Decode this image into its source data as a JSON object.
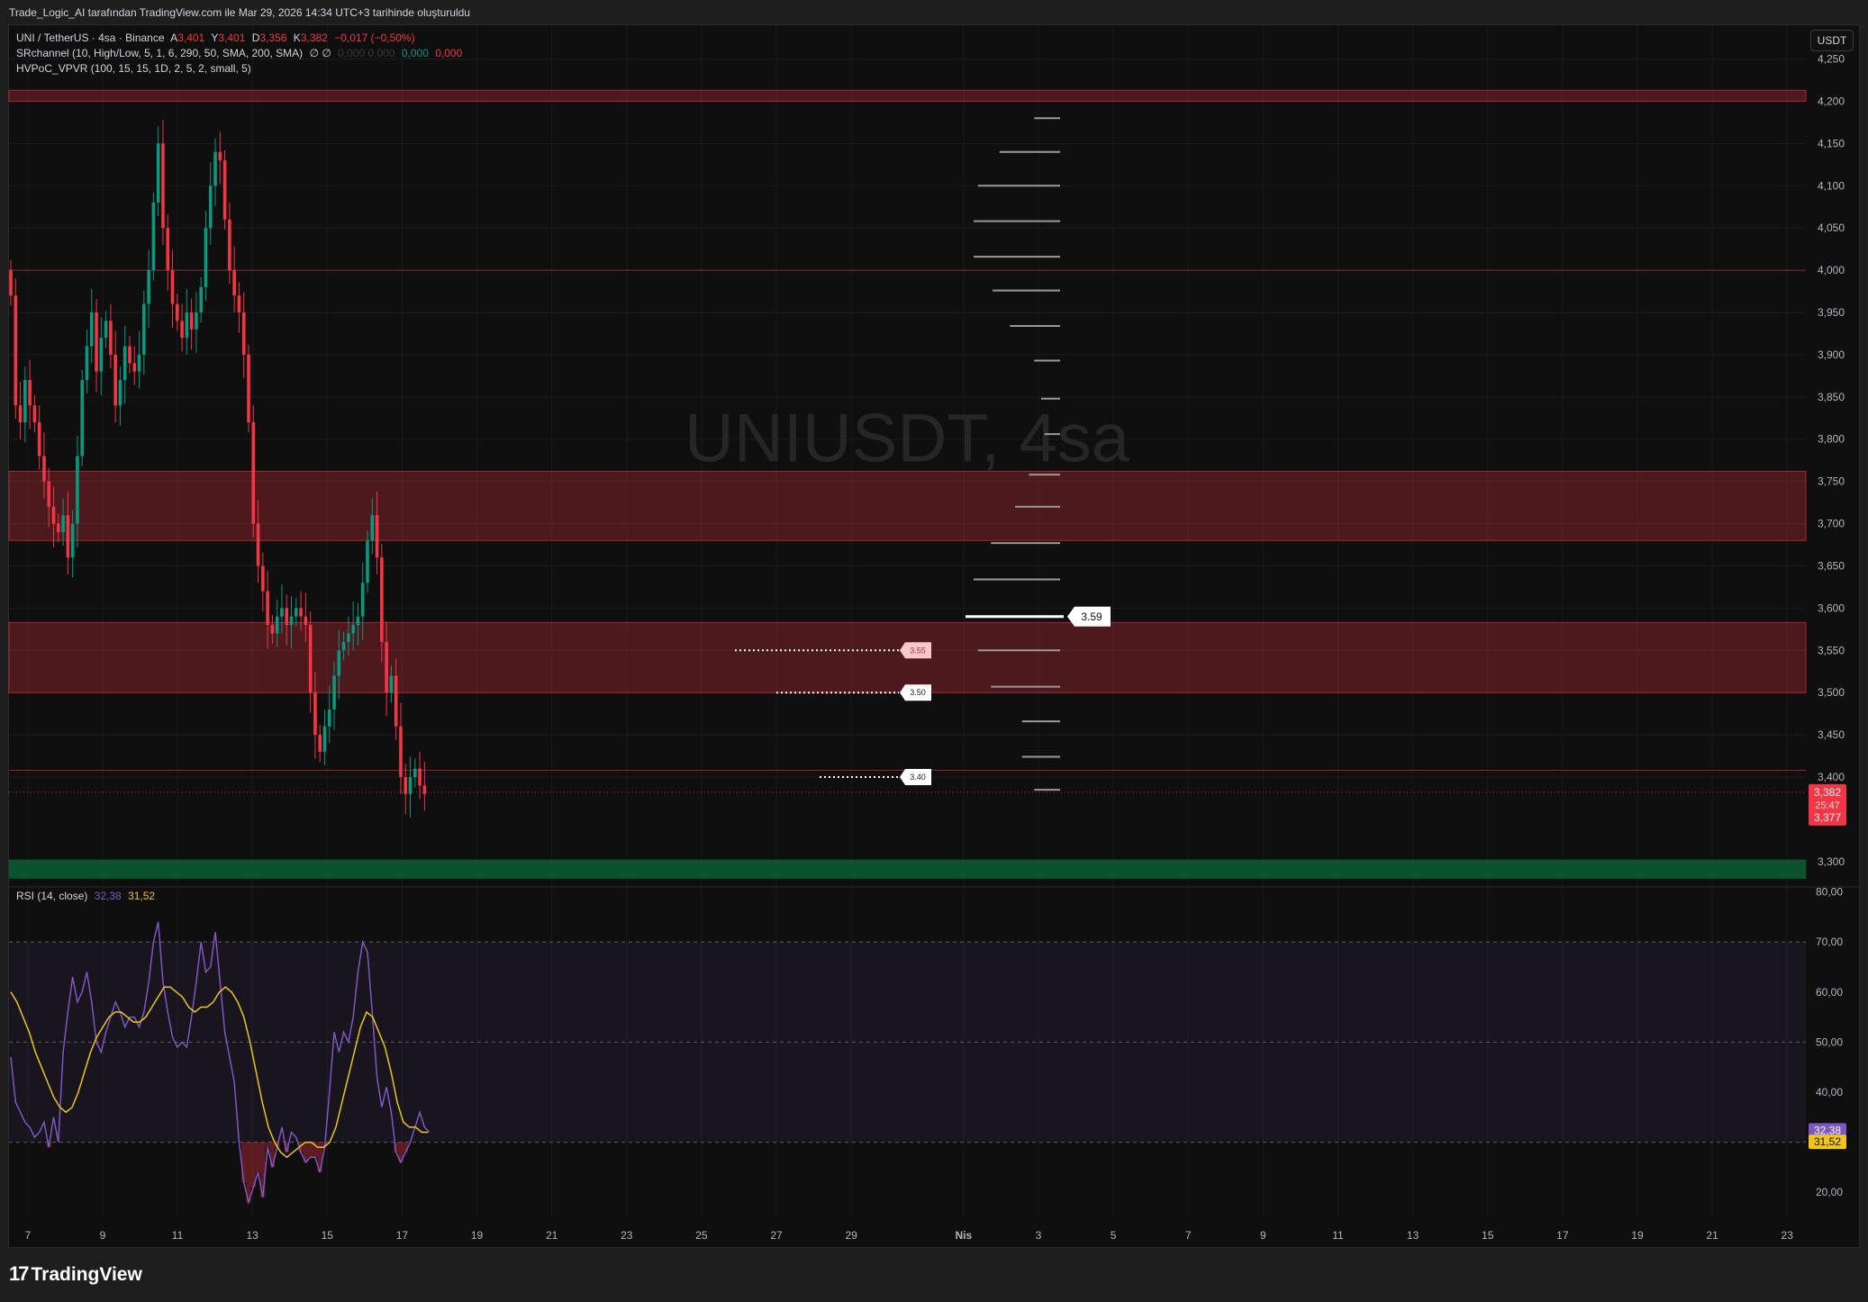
{
  "header": {
    "attribution": "Trade_Logic_AI tarafından TradingView.com ile Mar 29, 2026 14:34 UTC+3 tarihinde oluşturuldu"
  },
  "legend": {
    "symbol": "UNI / TetherUS · 4sa · Binance",
    "open_label": "A",
    "open": "3,401",
    "high_label": "Y",
    "high": "3,401",
    "low_label": "D",
    "low": "3,356",
    "close_label": "K",
    "close": "3,382",
    "change": "−0,017 (−0,50%)",
    "indicator1": "SRchannel (10, High/Low, 5, 1, 6, 290, 50, SMA, 200, SMA)",
    "indicator1_icon": "∅ ∅",
    "indicator1_dim": "0,000 0,000",
    "indicator1_v1": "0,000",
    "indicator1_v2": "0,000",
    "indicator2": "HVPoC_VPVR (100, 15, 15, 1D, 2, 5, 2, small, 5)",
    "rsi_label": "RSI (14, close)",
    "rsi_value": "32,38",
    "rsi_ma_value": "31,52"
  },
  "currency_button": "USDT",
  "watermark": "UNIUSDT, 4sa",
  "brand": {
    "logo": "17",
    "name": "TradingView"
  },
  "colors": {
    "up": "#089981",
    "down": "#f23645",
    "zone": "#f23645",
    "support": "#0b5e34",
    "rsi": "#7e57c2",
    "rsi_ma": "#f0c419",
    "background": "#0f0f0f"
  },
  "chart_data": [
    {
      "type": "candlestick",
      "title": "UNIUSDT, 4sa",
      "ylim": [
        3.27,
        4.29
      ],
      "y_ticks": [
        "4,250",
        "4,200",
        "4,150",
        "4,100",
        "4,050",
        "4,000",
        "3,950",
        "3,900",
        "3,850",
        "3,800",
        "3,750",
        "3,700",
        "3,650",
        "3,600",
        "3,550",
        "3,500",
        "3,450",
        "3,400",
        "3,300"
      ],
      "x_ticks": [
        "7",
        "9",
        "11",
        "13",
        "15",
        "17",
        "19",
        "21",
        "23",
        "25",
        "27",
        "29",
        "Nis",
        "3",
        "5",
        "7",
        "9",
        "11",
        "13",
        "15",
        "17",
        "19",
        "21",
        "23"
      ],
      "x_tick_values": [
        7,
        9,
        11,
        13,
        15,
        17,
        19,
        21,
        23,
        25,
        27,
        29,
        32,
        34,
        36,
        38,
        40,
        42,
        44,
        46,
        48,
        50,
        52,
        54
      ],
      "xlim": [
        6.5,
        54.5
      ],
      "last_price_label": "3,382",
      "countdown_label": "25:47",
      "last_low_label": "3,377",
      "last_price": 3.382,
      "zones": [
        {
          "from": 4.2,
          "to": 4.213,
          "kind": "resistance"
        },
        {
          "from": 3.68,
          "to": 3.762,
          "kind": "resistance"
        },
        {
          "from": 3.5,
          "to": 3.583,
          "kind": "resistance"
        },
        {
          "from": 3.28,
          "to": 3.302,
          "kind": "support"
        }
      ],
      "levels": [
        4.0,
        3.408
      ],
      "hvpoc": {
        "price": 3.59,
        "label": "3.59"
      },
      "price_tags": [
        {
          "price": 3.55,
          "label": "3.55",
          "style": "pink"
        },
        {
          "price": 3.5,
          "label": "3.50",
          "style": "white"
        },
        {
          "price": 3.4,
          "label": "3.40",
          "style": "white"
        }
      ],
      "volume_profile": [
        {
          "price": 4.18,
          "size": 0.3
        },
        {
          "price": 4.14,
          "size": 0.7
        },
        {
          "price": 4.1,
          "size": 0.95
        },
        {
          "price": 4.058,
          "size": 1.0
        },
        {
          "price": 4.016,
          "size": 1.0
        },
        {
          "price": 3.976,
          "size": 0.78
        },
        {
          "price": 3.934,
          "size": 0.58
        },
        {
          "price": 3.893,
          "size": 0.3
        },
        {
          "price": 3.848,
          "size": 0.22
        },
        {
          "price": 3.806,
          "size": 0.18
        },
        {
          "price": 3.758,
          "size": 0.36
        },
        {
          "price": 3.72,
          "size": 0.52
        },
        {
          "price": 3.677,
          "size": 0.8
        },
        {
          "price": 3.634,
          "size": 1.0
        },
        {
          "price": 3.55,
          "size": 0.95
        },
        {
          "price": 3.507,
          "size": 0.8
        },
        {
          "price": 3.466,
          "size": 0.44
        },
        {
          "price": 3.424,
          "size": 0.44
        },
        {
          "price": 3.385,
          "size": 0.3
        }
      ],
      "price_series": [
        3.97,
        3.84,
        3.82,
        3.87,
        3.84,
        3.82,
        3.78,
        3.75,
        3.72,
        3.7,
        3.69,
        3.71,
        3.66,
        3.7,
        3.78,
        3.87,
        3.91,
        3.95,
        3.88,
        3.92,
        3.94,
        3.9,
        3.84,
        3.87,
        3.91,
        3.89,
        3.88,
        3.9,
        3.96,
        4.0,
        4.08,
        4.15,
        4.05,
        4.0,
        3.96,
        3.94,
        3.92,
        3.95,
        3.93,
        3.95,
        3.98,
        4.05,
        4.1,
        4.14,
        4.13,
        4.06,
        4.0,
        3.97,
        3.95,
        3.9,
        3.82,
        3.7,
        3.65,
        3.62,
        3.58,
        3.57,
        3.59,
        3.6,
        3.58,
        3.59,
        3.6,
        3.59,
        3.58,
        3.5,
        3.45,
        3.43,
        3.46,
        3.48,
        3.52,
        3.55,
        3.56,
        3.57,
        3.58,
        3.59,
        3.63,
        3.68,
        3.71,
        3.66,
        3.56,
        3.5,
        3.52,
        3.46,
        3.4,
        3.38,
        3.4,
        3.41,
        3.39,
        3.38
      ]
    },
    {
      "type": "line",
      "title": "RSI (14, close)",
      "ylim": [
        15,
        81
      ],
      "y_ticks": [
        "80,00",
        "70,00",
        "60,00",
        "50,00",
        "40,00",
        "30,00",
        "20,00"
      ],
      "bands": {
        "upper": 70,
        "middle": 50,
        "lower": 30
      },
      "series": [
        {
          "name": "RSI",
          "color": "#7e57c2",
          "last_label": "32,38",
          "values": [
            47,
            38,
            36,
            34,
            33,
            31,
            32,
            34,
            29,
            35,
            30,
            48,
            56,
            63,
            58,
            60,
            64,
            58,
            50,
            48,
            52,
            55,
            58,
            56,
            53,
            55,
            55,
            53,
            56,
            62,
            70,
            74,
            62,
            56,
            51,
            49,
            50,
            49,
            55,
            62,
            70,
            64,
            65,
            72,
            62,
            52,
            47,
            42,
            30,
            22,
            18,
            21,
            24,
            19,
            29,
            25,
            29,
            33,
            28,
            32,
            31,
            28,
            26,
            27,
            27,
            24,
            29,
            40,
            52,
            48,
            52,
            50,
            55,
            64,
            70,
            68,
            56,
            43,
            37,
            41,
            36,
            28,
            26,
            28,
            30,
            33,
            36,
            33,
            32
          ]
        },
        {
          "name": "RSI-based MA",
          "color": "#f0c419",
          "last_label": "31,52",
          "values": [
            60,
            58,
            55,
            52,
            48,
            45,
            42,
            39,
            37,
            36,
            37,
            40,
            44,
            48,
            51,
            53,
            55,
            56,
            56,
            55,
            54,
            54,
            55,
            57,
            59,
            61,
            61,
            60,
            59,
            57,
            56,
            57,
            57,
            58,
            60,
            61,
            60,
            58,
            55,
            50,
            44,
            38,
            33,
            30,
            28,
            27,
            28,
            29,
            30,
            30,
            29,
            29,
            30,
            33,
            38,
            43,
            48,
            53,
            56,
            55,
            52,
            49,
            44,
            38,
            34,
            33,
            33,
            32,
            32
          ]
        }
      ]
    }
  ]
}
